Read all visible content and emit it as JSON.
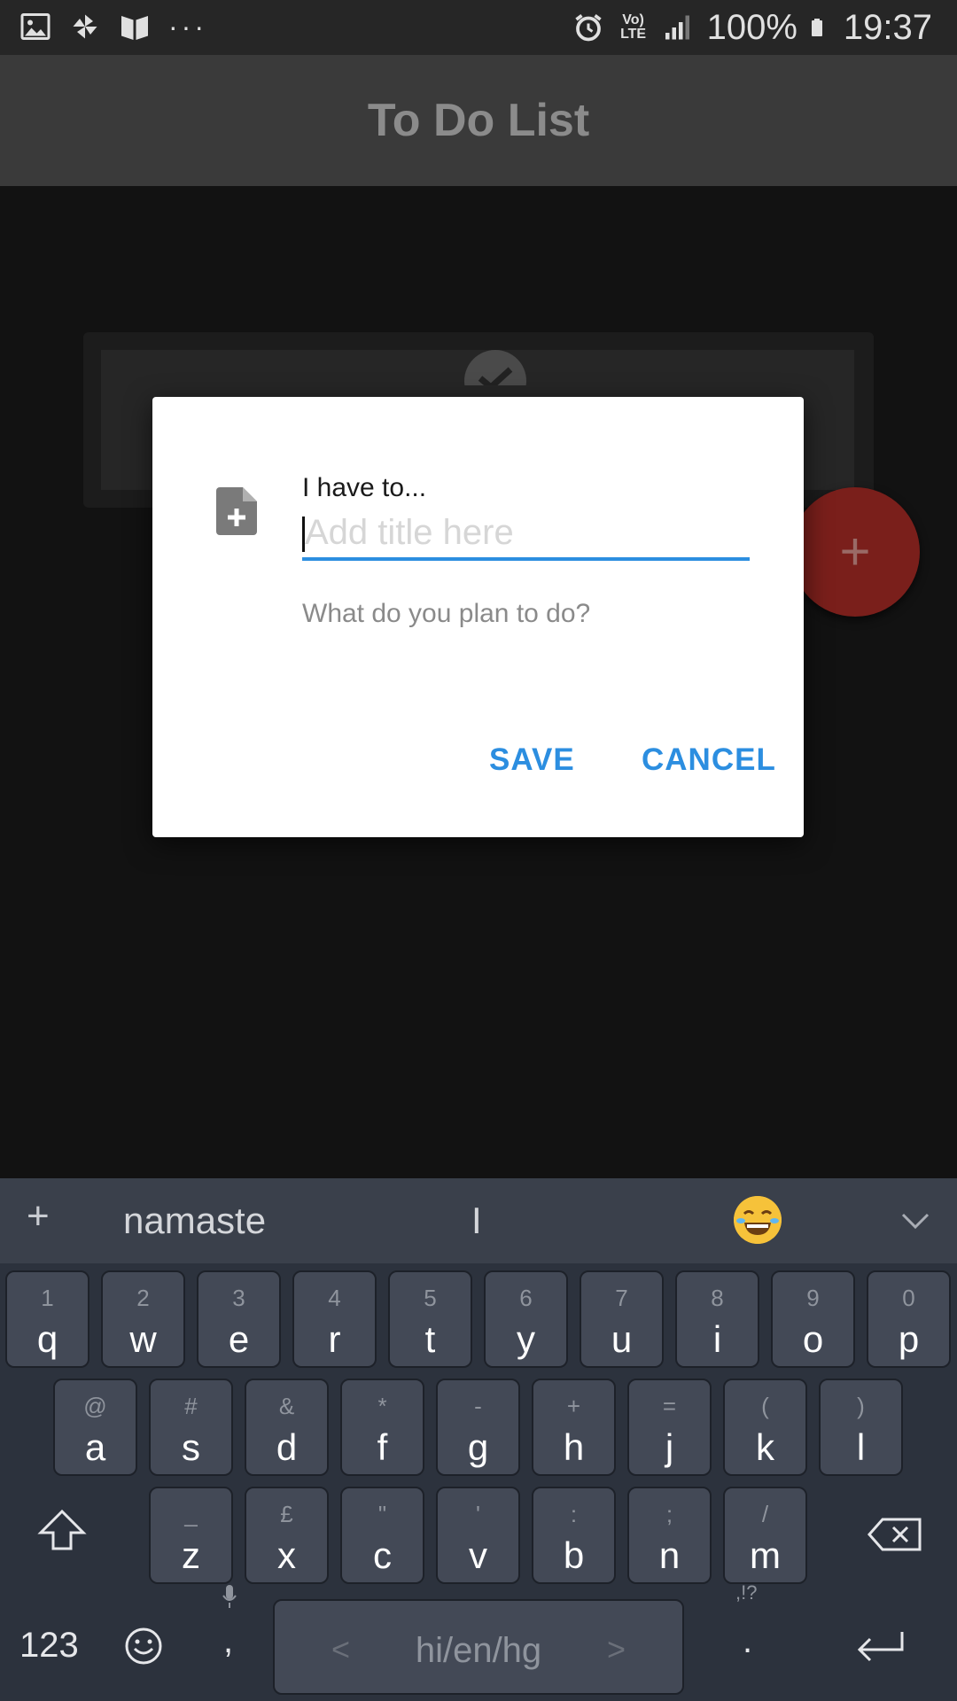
{
  "status_bar": {
    "battery": "100%",
    "time": "19:37",
    "network": "Vo) LTE",
    "more": "···"
  },
  "app_bar": {
    "title": "To Do List"
  },
  "dialog": {
    "label": "I have to...",
    "title_placeholder": "Add title here",
    "description_hint": "What do you plan to do?",
    "save_label": "SAVE",
    "cancel_label": "CANCEL"
  },
  "fab": {
    "label": "+"
  },
  "keyboard": {
    "suggestions": [
      "namaste",
      "I"
    ],
    "add_label": "+",
    "row1": [
      {
        "main": "q",
        "sub": "1"
      },
      {
        "main": "w",
        "sub": "2"
      },
      {
        "main": "e",
        "sub": "3"
      },
      {
        "main": "r",
        "sub": "4"
      },
      {
        "main": "t",
        "sub": "5"
      },
      {
        "main": "y",
        "sub": "6"
      },
      {
        "main": "u",
        "sub": "7"
      },
      {
        "main": "i",
        "sub": "8"
      },
      {
        "main": "o",
        "sub": "9"
      },
      {
        "main": "p",
        "sub": "0"
      }
    ],
    "row2": [
      {
        "main": "a",
        "sub": "@"
      },
      {
        "main": "s",
        "sub": "#"
      },
      {
        "main": "d",
        "sub": "&"
      },
      {
        "main": "f",
        "sub": "*"
      },
      {
        "main": "g",
        "sub": "-"
      },
      {
        "main": "h",
        "sub": "+"
      },
      {
        "main": "j",
        "sub": "="
      },
      {
        "main": "k",
        "sub": "("
      },
      {
        "main": "l",
        "sub": ")"
      }
    ],
    "row3": [
      {
        "main": "z",
        "sub": "_"
      },
      {
        "main": "x",
        "sub": "£"
      },
      {
        "main": "c",
        "sub": "\""
      },
      {
        "main": "v",
        "sub": "'"
      },
      {
        "main": "b",
        "sub": ":"
      },
      {
        "main": "n",
        "sub": ";"
      },
      {
        "main": "m",
        "sub": "/"
      }
    ],
    "symbols_label": "123",
    "comma_label": ",",
    "period_label": ".",
    "period_sub": ",!?",
    "space_label": "hi/en/hg",
    "space_left": "<",
    "space_right": ">"
  }
}
